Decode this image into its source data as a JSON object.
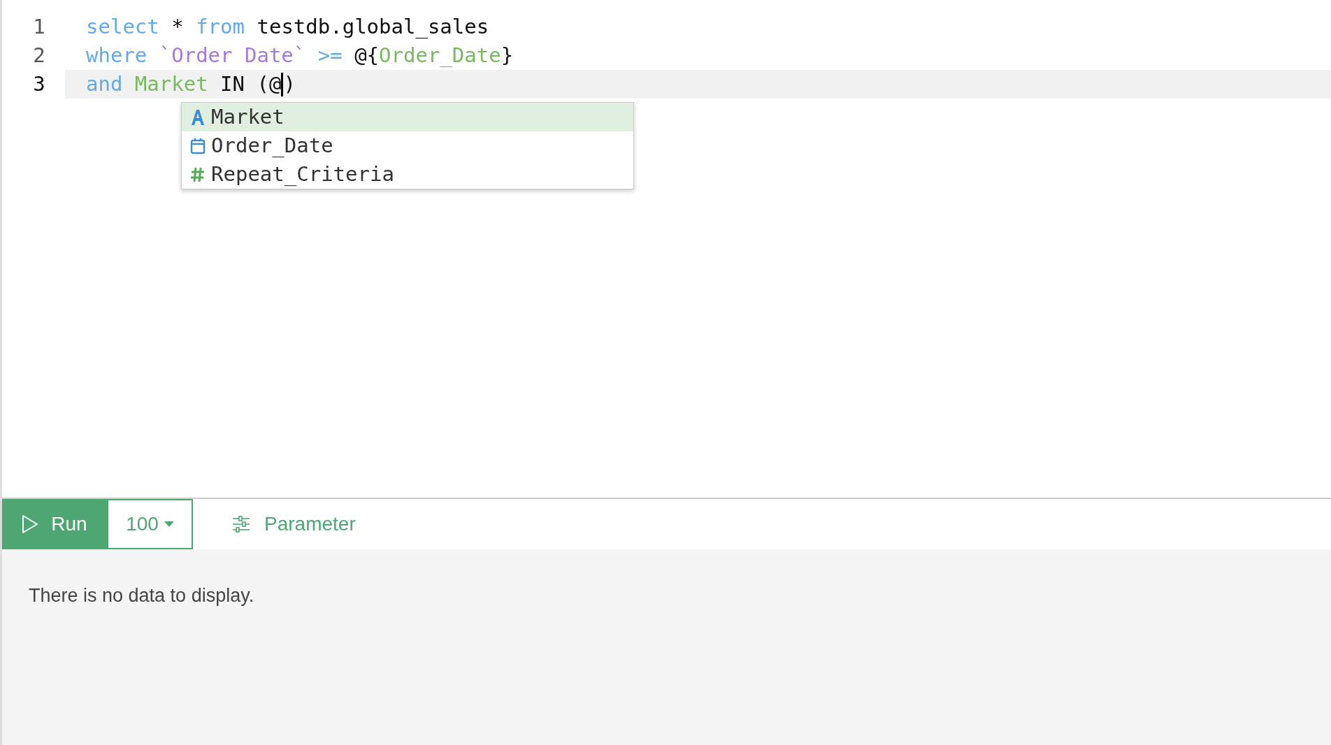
{
  "editor": {
    "lines": [
      {
        "number": "1",
        "current": false,
        "tokens": [
          {
            "kind": "keyword",
            "text": "select"
          },
          {
            "kind": "plain",
            "text": " * "
          },
          {
            "kind": "keyword",
            "text": "from"
          },
          {
            "kind": "plain",
            "text": " testdb.global_sales"
          }
        ]
      },
      {
        "number": "2",
        "current": false,
        "tokens": [
          {
            "kind": "keyword",
            "text": "where"
          },
          {
            "kind": "string",
            "text": " `Order Date`"
          },
          {
            "kind": "keyword",
            "text": " >="
          },
          {
            "kind": "plain",
            "text": " @{"
          },
          {
            "kind": "variable",
            "text": "Order_Date"
          },
          {
            "kind": "plain",
            "text": "}"
          }
        ]
      },
      {
        "number": "3",
        "current": true,
        "tokens": [
          {
            "kind": "keyword",
            "text": "and"
          },
          {
            "kind": "variable",
            "text": " Market"
          },
          {
            "kind": "plain",
            "text": " IN (@"
          },
          {
            "kind": "caret"
          },
          {
            "kind": "plain",
            "text": ")"
          }
        ]
      }
    ],
    "autocomplete": [
      {
        "kind": "text",
        "label": "Market",
        "selected": true
      },
      {
        "kind": "date",
        "label": "Order_Date",
        "selected": false
      },
      {
        "kind": "number",
        "label": "Repeat_Criteria",
        "selected": false
      }
    ]
  },
  "toolbar": {
    "run": "Run",
    "limit": "100",
    "parameter": "Parameter"
  },
  "results": {
    "message": "There is no data to display."
  }
}
